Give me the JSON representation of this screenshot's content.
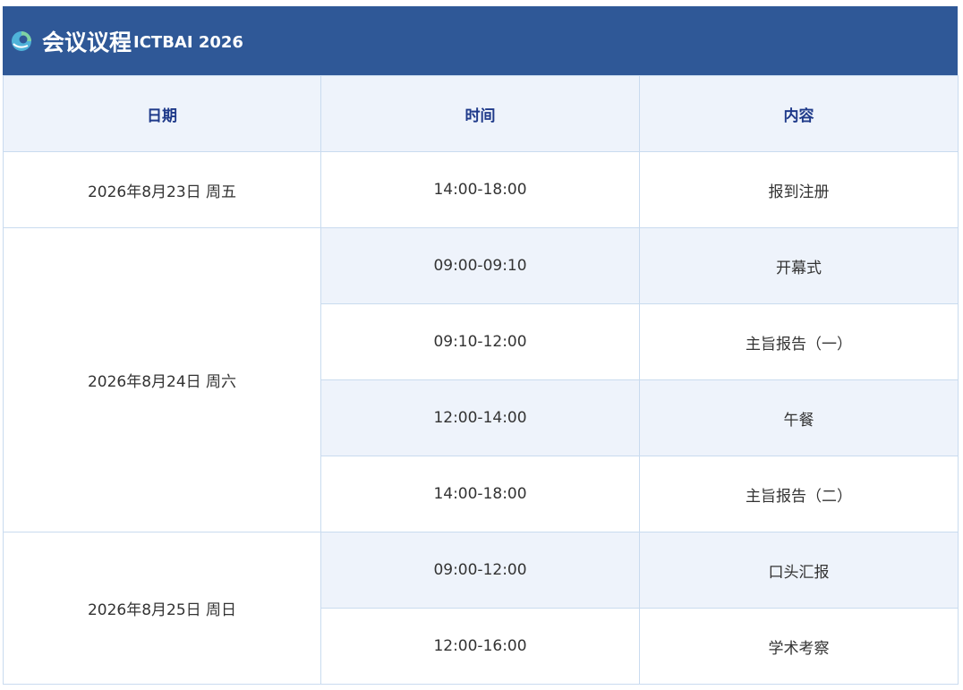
{
  "header": {
    "title": "会议议程",
    "subtitle": "ICTBAI 2026",
    "colors": {
      "bar": "#2f5897",
      "header_text": "#1f3a8a",
      "shade": "#eef3fb"
    }
  },
  "table": {
    "columns": [
      "日期",
      "时间",
      "内容"
    ],
    "groups": [
      {
        "date": "2026年8月23日  周五",
        "rows": [
          {
            "time": "14:00-18:00",
            "content": "报到注册"
          }
        ]
      },
      {
        "date": "2026年8月24日 周六",
        "rows": [
          {
            "time": "09:00-09:10",
            "content": "开幕式"
          },
          {
            "time": "09:10-12:00",
            "content": "主旨报告（一）"
          },
          {
            "time": "12:00-14:00",
            "content": "午餐"
          },
          {
            "time": "14:00-18:00",
            "content": "主旨报告（二）"
          }
        ]
      },
      {
        "date": "2026年8月25日 周日",
        "rows": [
          {
            "time": "09:00-12:00",
            "content": "口头汇报"
          },
          {
            "time": "12:00-16:00",
            "content": "学术考察"
          }
        ]
      }
    ]
  }
}
